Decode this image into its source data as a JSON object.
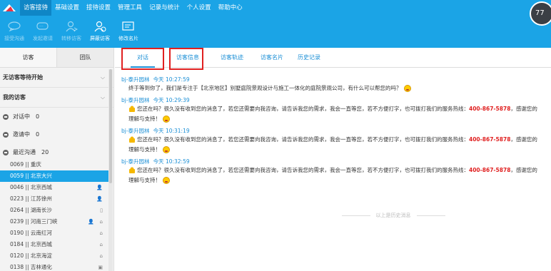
{
  "menu": [
    "访客接待",
    "基础设置",
    "接待设置",
    "管理工具",
    "记录与统计",
    "个人设置",
    "帮助中心"
  ],
  "avatar_text": "77",
  "toolbar": [
    {
      "label": "接受沟通",
      "icon": "chat-accept-icon",
      "enabled": false
    },
    {
      "label": "发起邀请",
      "icon": "invite-icon",
      "enabled": false
    },
    {
      "label": "转移访客",
      "icon": "transfer-user-icon",
      "enabled": false
    },
    {
      "label": "屏蔽访客",
      "icon": "block-user-icon",
      "enabled": true
    },
    {
      "label": "修改名片",
      "icon": "edit-card-icon",
      "enabled": true
    }
  ],
  "left": {
    "tabs": [
      "访客",
      "团队"
    ],
    "sections": [
      "无访客等待开始",
      "我的访客"
    ],
    "groups": [
      {
        "label": "对话中",
        "count": "0"
      },
      {
        "label": "邀请中",
        "count": "0"
      },
      {
        "label": "最近沟通",
        "count": "20"
      }
    ],
    "visitors": [
      {
        "id": "0069",
        "loc": "重庆",
        "selected": false,
        "icons": []
      },
      {
        "id": "0059",
        "loc": "北京大兴",
        "selected": true,
        "icons": []
      },
      {
        "id": "0046",
        "loc": "北京西城",
        "selected": false,
        "icons": [
          "user"
        ]
      },
      {
        "id": "0223",
        "loc": "江苏徐州",
        "selected": false,
        "icons": [
          "user"
        ]
      },
      {
        "id": "0264",
        "loc": "湖南长沙",
        "selected": false,
        "icons": [
          "mobile"
        ]
      },
      {
        "id": "0239",
        "loc": "河南三门峡",
        "selected": false,
        "icons": [
          "user",
          "home"
        ]
      },
      {
        "id": "0190",
        "loc": "云南红河",
        "selected": false,
        "icons": [
          "home"
        ]
      },
      {
        "id": "0184",
        "loc": "北京西城",
        "selected": false,
        "icons": [
          "home"
        ]
      },
      {
        "id": "0120",
        "loc": "北京海淀",
        "selected": false,
        "icons": [
          "home"
        ]
      },
      {
        "id": "0138",
        "loc": "吉林通化",
        "selected": false,
        "icons": [
          "window"
        ]
      }
    ]
  },
  "right": {
    "tabs": [
      "对话",
      "访客信息",
      "访客轨迹",
      "访客名片",
      "历史记录"
    ],
    "active_tab": "对话",
    "messages": [
      {
        "sender": "bj-泰升园林",
        "time": "今天 10:27:59",
        "text": "终于等到你了，我们是专注于【北京地区】别墅庭院景观设计与施工一体化的庭院景观公司，有什么可以帮您的吗？",
        "hotline": "",
        "tail": ""
      },
      {
        "sender": "bj-泰升园林",
        "time": "今天 10:29:39",
        "text": "您还在吗？很久没有收到您的消息了，若您还需要向我咨询，请告诉我您的需求，我会一直等您，若不方便打字，也可拨打我们的服务热线：",
        "hotline": "400-867-5878",
        "tail": "，感谢您的理解与支持！"
      },
      {
        "sender": "bj-泰升园林",
        "time": "今天 10:31:19",
        "text": "您还在吗？很久没有收到您的消息了，若您还需要向我咨询，请告诉我您的需求，我会一直等您，若不方便打字，也可拨打我们的服务热线：",
        "hotline": "400-867-5878",
        "tail": "，感谢您的理解与支持！"
      },
      {
        "sender": "bj-泰升园林",
        "time": "今天 10:32:59",
        "text": "您还在吗？很久没有收到您的消息了，若您还需要向我咨询，请告诉我您的需求，我会一直等您，若不方便打字，也可拨打我们的服务热线：",
        "hotline": "400-867-5878",
        "tail": "，感谢您的理解与支持！"
      }
    ],
    "history_divider": "以上是历史消息"
  },
  "colors": {
    "brand": "#1ba4e6",
    "highlight": "#e02020",
    "link": "#1b8fd6"
  }
}
